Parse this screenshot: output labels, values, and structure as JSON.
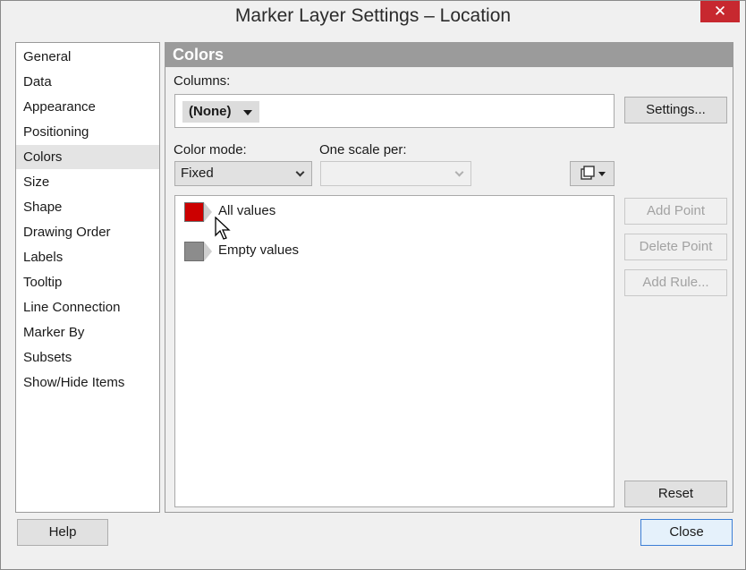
{
  "window": {
    "title": "Marker Layer Settings – Location",
    "close_glyph": "✕"
  },
  "nav": {
    "items": [
      {
        "label": "General"
      },
      {
        "label": "Data"
      },
      {
        "label": "Appearance"
      },
      {
        "label": "Positioning"
      },
      {
        "label": "Colors",
        "selected": true
      },
      {
        "label": "Size"
      },
      {
        "label": "Shape"
      },
      {
        "label": "Drawing Order"
      },
      {
        "label": "Labels"
      },
      {
        "label": "Tooltip"
      },
      {
        "label": "Line Connection"
      },
      {
        "label": "Marker By"
      },
      {
        "label": "Subsets"
      },
      {
        "label": "Show/Hide Items"
      }
    ]
  },
  "panel": {
    "header": "Colors",
    "columns_label": "Columns:",
    "columns_value": "(None)",
    "settings_button": "Settings...",
    "color_mode_label": "Color mode:",
    "color_mode_value": "Fixed",
    "scale_per_label": "One scale per:",
    "scale_per_value": "",
    "values": [
      {
        "label": "All values",
        "color": "#cc0000"
      },
      {
        "label": "Empty values",
        "color": "#8c8c8c"
      }
    ],
    "add_point_button": "Add Point",
    "delete_point_button": "Delete Point",
    "add_rule_button": "Add Rule...",
    "reset_button": "Reset"
  },
  "footer": {
    "help_button": "Help",
    "close_button": "Close"
  }
}
